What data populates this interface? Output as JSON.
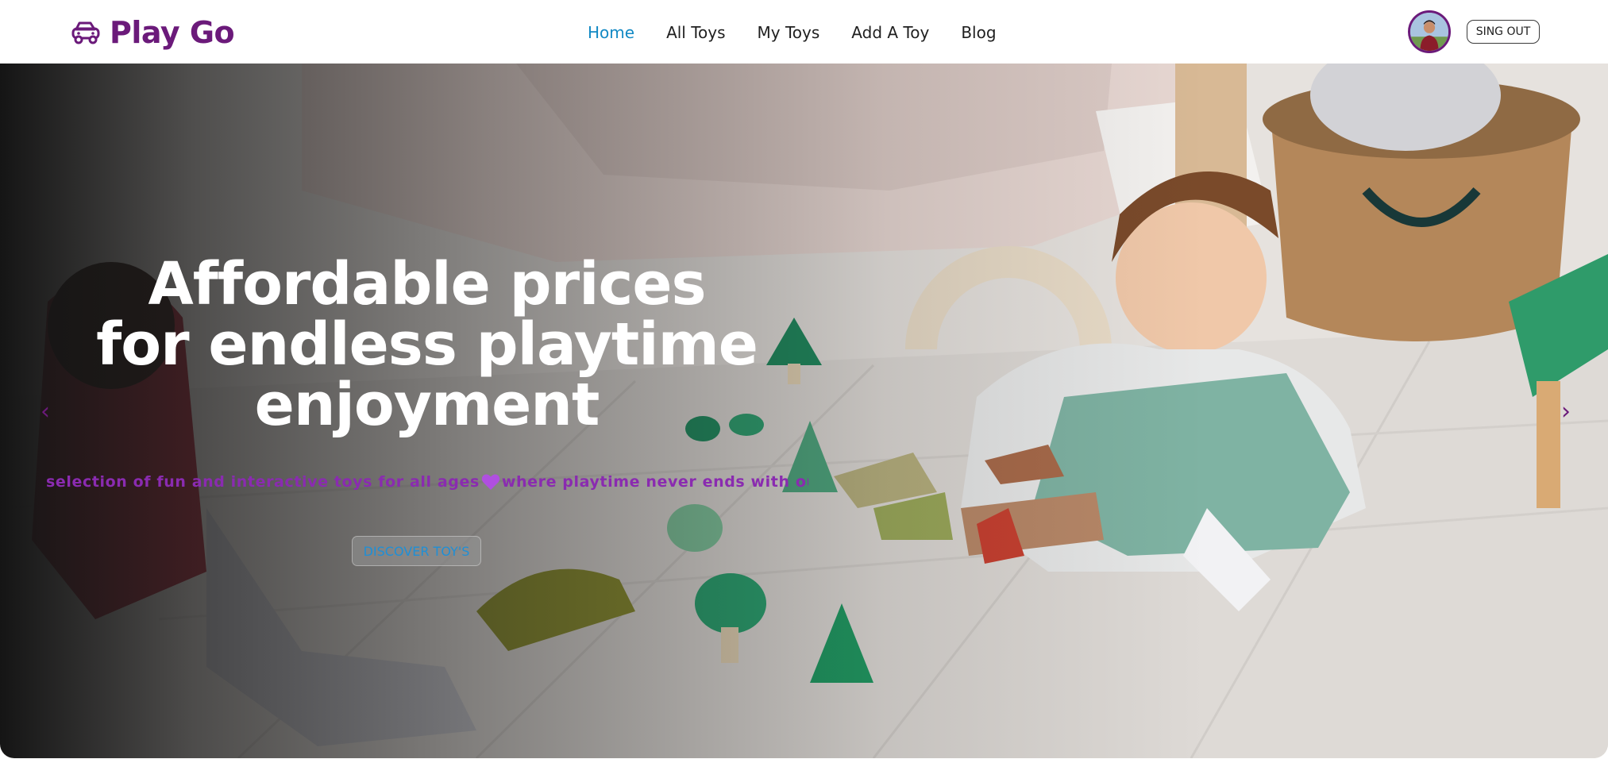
{
  "brand": {
    "name": "Play Go",
    "logo_icon": "toy-car-icon",
    "color": "#6b1a7a"
  },
  "nav": {
    "items": [
      {
        "label": "Home",
        "active": true
      },
      {
        "label": "All Toys",
        "active": false
      },
      {
        "label": "My Toys",
        "active": false
      },
      {
        "label": "Add A Toy",
        "active": false
      },
      {
        "label": "Blog",
        "active": false
      }
    ],
    "active_color": "#1289c4"
  },
  "user": {
    "avatar_icon": "user-avatar",
    "signout_label": "SING OUT"
  },
  "hero": {
    "title": "Affordable prices for endless playtime enjoyment",
    "marquee_left": "selection of fun and interactive toys for all ages",
    "marquee_icon": "heart-icon",
    "marquee_right": "where playtime never ends with our w",
    "cta_label": "DISCOVER TOY'S",
    "prev_arrow": "‹",
    "next_arrow": "›",
    "accent_color": "#8a2bb0"
  }
}
